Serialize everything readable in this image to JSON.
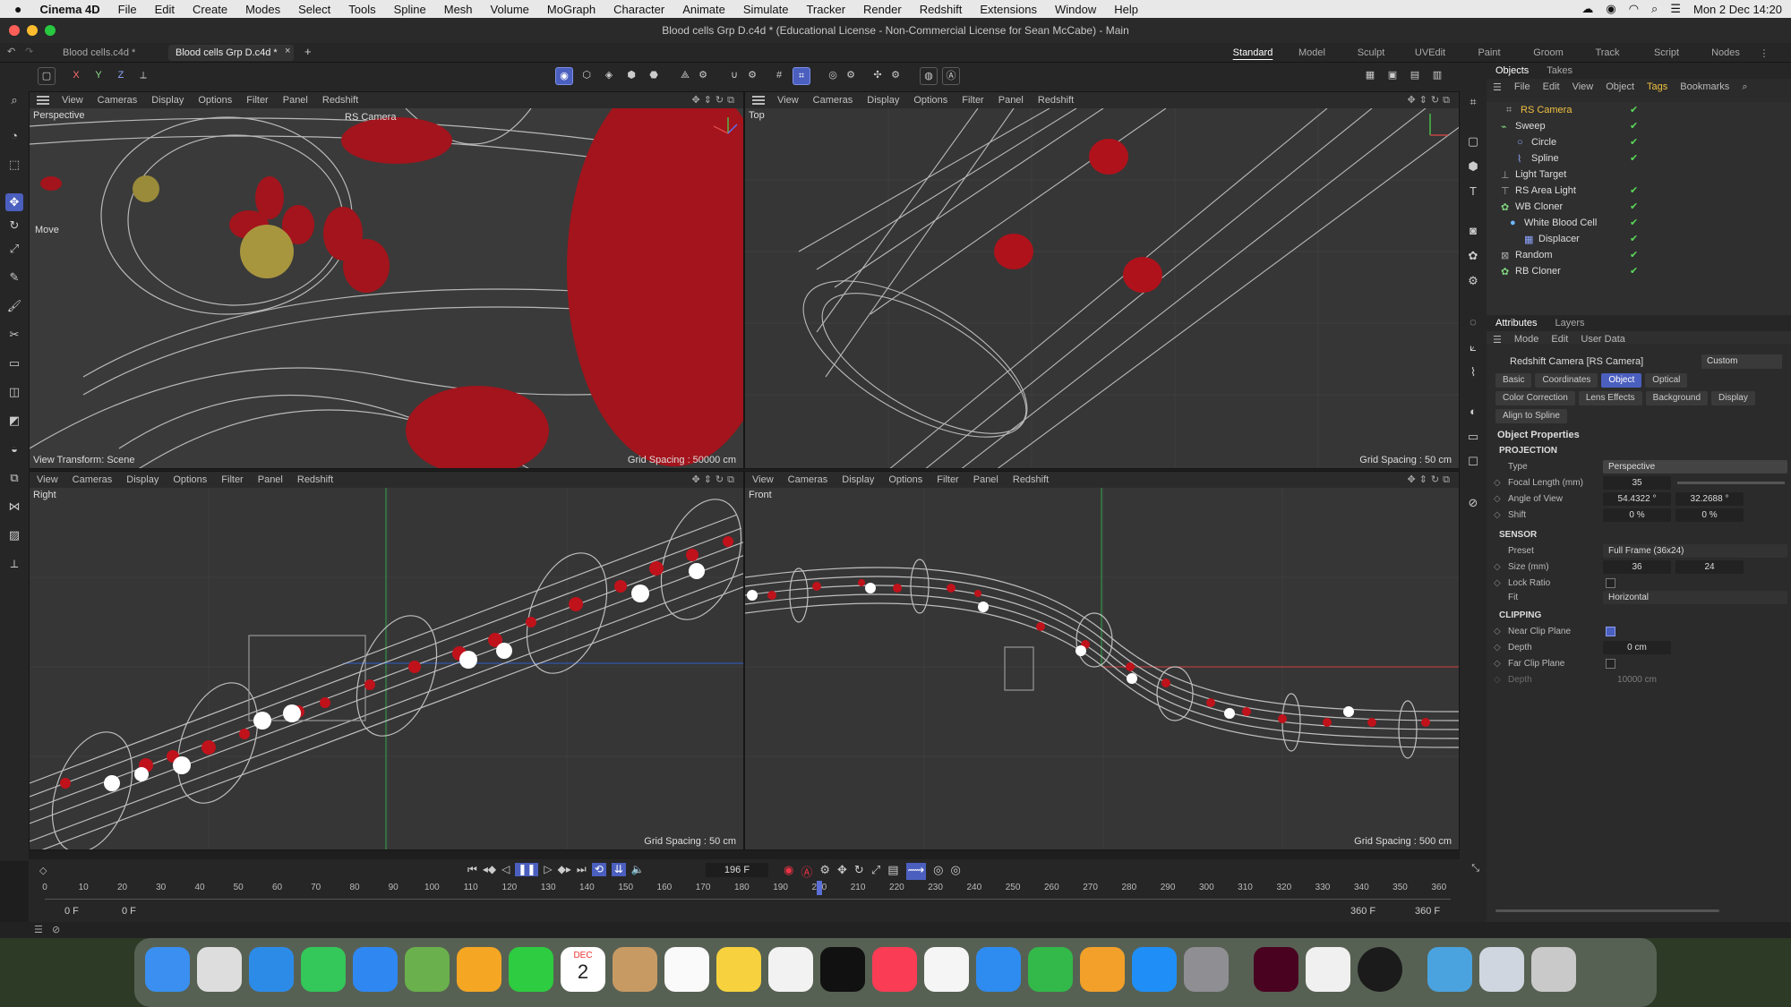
{
  "menubar": {
    "app": "Cinema 4D",
    "items": [
      "File",
      "Edit",
      "Create",
      "Modes",
      "Select",
      "Tools",
      "Spline",
      "Mesh",
      "Volume",
      "MoGraph",
      "Character",
      "Animate",
      "Simulate",
      "Tracker",
      "Render",
      "Redshift",
      "Extensions",
      "Window",
      "Help"
    ],
    "clock": "Mon 2 Dec  14:20"
  },
  "window": {
    "title": "Blood cells Grp D.c4d * (Educational License - Non-Commercial License for Sean McCabe) - Main"
  },
  "tabs": {
    "doc1": "Blood cells.c4d *",
    "doc2": "Blood cells Grp D.c4d *",
    "layouts": [
      "Standard",
      "Model",
      "Sculpt",
      "UVEdit",
      "Paint",
      "Groom",
      "Track",
      "Script",
      "Nodes"
    ]
  },
  "toolbar": {
    "x": "X",
    "y": "Y",
    "z": "Z"
  },
  "viewport_menu": [
    "View",
    "Cameras",
    "Display",
    "Options",
    "Filter",
    "Panel",
    "Redshift"
  ],
  "viewports": {
    "perspective": {
      "name": "Perspective",
      "camera": "RS Camera",
      "move_label": "Move",
      "transform": "View Transform: Scene",
      "grid": "Grid Spacing : 50000 cm"
    },
    "top": {
      "name": "Top",
      "grid": "Grid Spacing : 50 cm"
    },
    "right": {
      "name": "Right",
      "grid": "Grid Spacing : 50 cm"
    },
    "front": {
      "name": "Front",
      "grid": "Grid Spacing : 500 cm"
    }
  },
  "timeline": {
    "frame": "196 F",
    "start": "0 F",
    "start2": "0 F",
    "end": "360 F",
    "end2": "360 F",
    "ticks": [
      "0",
      "10",
      "20",
      "30",
      "40",
      "50",
      "60",
      "70",
      "80",
      "90",
      "100",
      "110",
      "120",
      "130",
      "140",
      "150",
      "160",
      "170",
      "180",
      "190",
      "200",
      "210",
      "220",
      "230",
      "240",
      "250",
      "260",
      "270",
      "280",
      "290",
      "300",
      "310",
      "320",
      "330",
      "340",
      "350",
      "360"
    ]
  },
  "objects_panel": {
    "tabs": [
      "Objects",
      "Takes"
    ],
    "menu": [
      "File",
      "Edit",
      "View",
      "Object",
      "Tags",
      "Bookmarks"
    ],
    "items": [
      "RS Camera",
      "Sweep",
      "Circle",
      "Spline",
      "Light Target",
      "RS Area Light",
      "WB Cloner",
      "White Blood Cell",
      "Displacer",
      "Random",
      "RB Cloner"
    ]
  },
  "attributes": {
    "tabs": [
      "Attributes",
      "Layers"
    ],
    "menu": [
      "Mode",
      "Edit",
      "User Data"
    ],
    "object_title": "Redshift Camera [RS Camera]",
    "preset": "Custom",
    "row1": [
      "Basic",
      "Coordinates",
      "Object",
      "Optical"
    ],
    "row2": [
      "Color Correction",
      "Lens Effects",
      "Background",
      "Display"
    ],
    "align": "Align to Spline",
    "section": "Object Properties",
    "projection": "PROJECTION",
    "type_label": "Type",
    "type_value": "Perspective",
    "focal_label": "Focal Length (mm)",
    "focal_value": "35",
    "aov_label": "Angle of View",
    "aov_1": "54.4322 °",
    "aov_2": "32.2688 °",
    "shift_label": "Shift",
    "shift_1": "0 %",
    "shift_2": "0 %",
    "sensor": "SENSOR",
    "preset_label": "Preset",
    "preset_value": "Full Frame (36x24)",
    "size_label": "Size (mm)",
    "size_1": "36",
    "size_2": "24",
    "lock_label": "Lock Ratio",
    "fit_label": "Fit",
    "fit_value": "Horizontal",
    "clipping": "CLIPPING",
    "near_label": "Near Clip Plane",
    "depth_label": "Depth",
    "depth_value": "0 cm",
    "far_label": "Far Clip Plane",
    "depth2_label": "Depth",
    "depth2_value": "10000 cm"
  },
  "dock": {
    "calendar_month": "DEC",
    "calendar_day": "2"
  },
  "colors": {
    "accent": "#4b5fbf",
    "blood": "#b0121b",
    "check": "#5ad85a"
  }
}
